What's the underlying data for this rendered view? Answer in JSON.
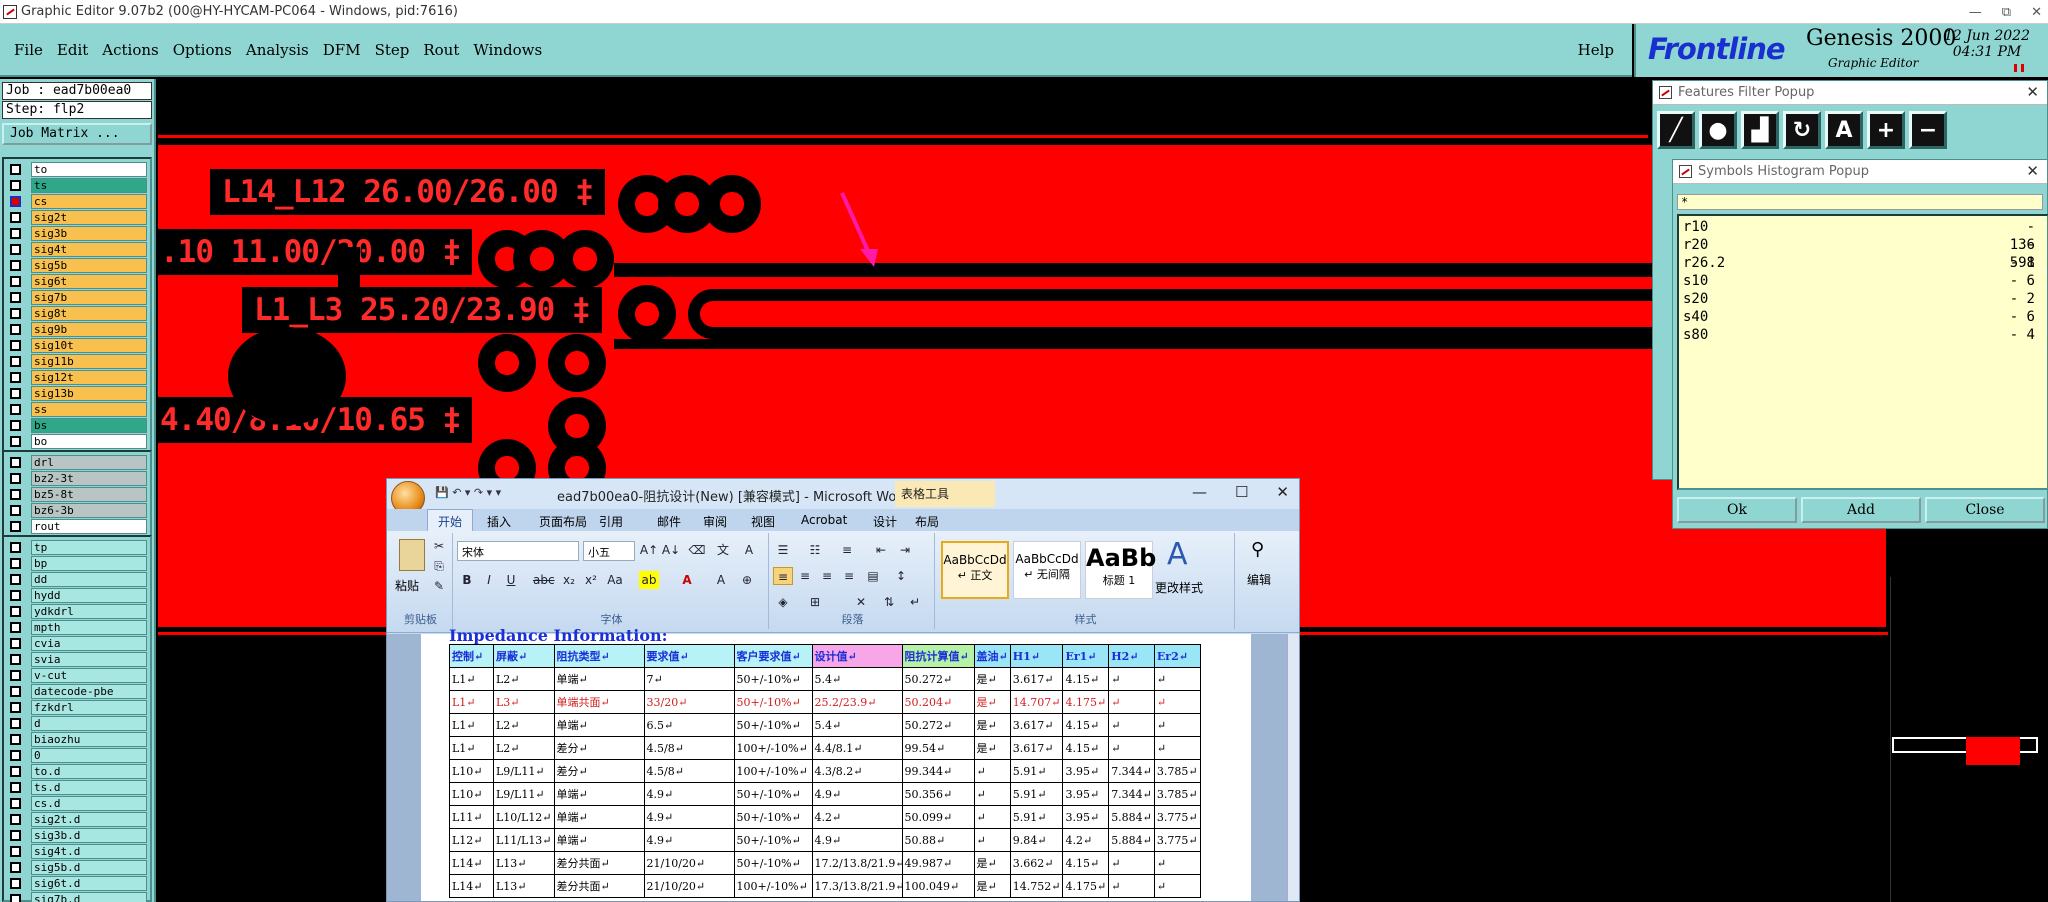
{
  "window": {
    "title": "Graphic Editor 9.07b2 (00@HY-HYCAM-PC064 - Windows, pid:7616)",
    "controls": [
      "—",
      "⧉",
      "✕"
    ]
  },
  "menu": {
    "items": [
      "File",
      "Edit",
      "Actions",
      "Options",
      "Analysis",
      "DFM",
      "Step",
      "Rout",
      "Windows"
    ],
    "help": "Help"
  },
  "brand": {
    "logo": "Frontline",
    "product": "Genesis 2000",
    "subtitle": "Graphic Editor",
    "date": "12 Jun 2022",
    "time": "04:31 PM"
  },
  "job": {
    "job_label": "Job : ead7b00ea0",
    "step_label": "Step: flp2",
    "matrix_button": "Job Matrix ..."
  },
  "layers": {
    "group1": [
      {
        "name": "to",
        "color": "white"
      },
      {
        "name": "ts",
        "color": "teal"
      },
      {
        "name": "cs",
        "color": "orange",
        "active": true
      },
      {
        "name": "sig2t",
        "color": "orange"
      },
      {
        "name": "sig3b",
        "color": "orange"
      },
      {
        "name": "sig4t",
        "color": "orange"
      },
      {
        "name": "sig5b",
        "color": "orange"
      },
      {
        "name": "sig6t",
        "color": "orange"
      },
      {
        "name": "sig7b",
        "color": "orange"
      },
      {
        "name": "sig8t",
        "color": "orange"
      },
      {
        "name": "sig9b",
        "color": "orange"
      },
      {
        "name": "sig10t",
        "color": "orange"
      },
      {
        "name": "sig11b",
        "color": "orange"
      },
      {
        "name": "sig12t",
        "color": "orange"
      },
      {
        "name": "sig13b",
        "color": "orange"
      },
      {
        "name": "ss",
        "color": "orange"
      },
      {
        "name": "bs",
        "color": "teal"
      },
      {
        "name": "bo",
        "color": "white"
      }
    ],
    "group2": [
      {
        "name": "drl",
        "color": "gray"
      },
      {
        "name": "bz2-3t",
        "color": "gray"
      },
      {
        "name": "bz5-8t",
        "color": "gray"
      },
      {
        "name": "bz6-3b",
        "color": "gray"
      },
      {
        "name": "rout",
        "color": "white"
      }
    ],
    "group3": [
      {
        "name": "tp",
        "color": "cyan"
      },
      {
        "name": "bp",
        "color": "cyan"
      },
      {
        "name": "dd",
        "color": "cyan"
      },
      {
        "name": "hydd",
        "color": "cyan"
      },
      {
        "name": "ydkdrl",
        "color": "cyan"
      },
      {
        "name": "mpth",
        "color": "cyan"
      },
      {
        "name": "cvia",
        "color": "cyan"
      },
      {
        "name": "svia",
        "color": "cyan"
      },
      {
        "name": "v-cut",
        "color": "cyan"
      },
      {
        "name": "datecode-pbe",
        "color": "cyan"
      },
      {
        "name": "fzkdrl",
        "color": "cyan"
      },
      {
        "name": "d",
        "color": "cyan"
      },
      {
        "name": "biaozhu",
        "color": "cyan"
      },
      {
        "name": "0",
        "color": "cyan"
      },
      {
        "name": "to.d",
        "color": "cyan"
      },
      {
        "name": "ts.d",
        "color": "cyan"
      },
      {
        "name": "cs.d",
        "color": "cyan"
      },
      {
        "name": "sig2t.d",
        "color": "cyan"
      },
      {
        "name": "sig3b.d",
        "color": "cyan"
      },
      {
        "name": "sig4t.d",
        "color": "cyan"
      },
      {
        "name": "sig5b.d",
        "color": "cyan"
      },
      {
        "name": "sig6t.d",
        "color": "cyan"
      },
      {
        "name": "sig7b.d",
        "color": "cyan"
      }
    ]
  },
  "canvas": {
    "labels": [
      "L14_L12 26.00/26.00 ‡",
      ".10 11.00/20.00 ‡",
      "L1_L3 25.20/23.90 ‡",
      "4.40/8.10/10.65 ‡"
    ],
    "colors": {
      "copper": "#ff0000",
      "background": "#000000",
      "arrow": "#ff1aa8"
    }
  },
  "features_filter": {
    "title": "Features Filter Popup",
    "tools": [
      "line-icon",
      "pad-icon",
      "surface-icon",
      "arc-icon",
      "text-icon",
      "plus-icon",
      "minus-icon"
    ]
  },
  "symbols_histogram": {
    "title": "Symbols Histogram Popup",
    "filter": "*",
    "rows": [
      {
        "sym": "r10",
        "count": "- 136"
      },
      {
        "sym": "r20",
        "count": "- 598"
      },
      {
        "sym": "r26.2",
        "count": "- 1"
      },
      {
        "sym": "s10",
        "count": "- 6"
      },
      {
        "sym": "s20",
        "count": "- 2"
      },
      {
        "sym": "s40",
        "count": "- 6"
      },
      {
        "sym": "s80",
        "count": "- 4"
      }
    ],
    "buttons": {
      "ok": "Ok",
      "add": "Add",
      "close": "Close"
    }
  },
  "word": {
    "title": "ead7b00ea0-阻抗设计(New) [兼容模式] - Microsoft Word",
    "table_tools": "表格工具",
    "tabs": [
      "开始",
      "插入",
      "页面布局",
      "引用",
      "邮件",
      "审阅",
      "视图",
      "Acrobat",
      "设计",
      "布局"
    ],
    "clipboard": {
      "paste": "粘贴",
      "group": "剪贴板"
    },
    "font": {
      "name": "宋体",
      "size": "小五",
      "group": "字体"
    },
    "paragraph": {
      "group": "段落"
    },
    "styles": {
      "s1": "AaBbCcDd",
      "s1_name": "↵ 正文",
      "s2": "AaBbCcDd",
      "s2_name": "↵ 无间隔",
      "s3": "AaBb",
      "s3_name": "标题 1",
      "change": "更改样式",
      "group": "样式"
    },
    "edit": {
      "label": "编辑"
    },
    "doc_heading": "Impedance Information:",
    "table": {
      "headers": [
        "控制↵",
        "屏蔽↵",
        "阻抗类型↵",
        "要求值↵",
        "客户要求值↵",
        "设计值↵",
        "阻抗计算值↵",
        "盖油↵",
        "H1↵",
        "Er1↵",
        "H2↵",
        "Er2↵"
      ],
      "rows": [
        [
          "L1↵",
          "L2↵",
          "单端↵",
          "7↵",
          "50+/-10%↵",
          "5.4↵",
          "50.272↵",
          "是↵",
          "3.617↵",
          "4.15↵",
          "↵",
          "↵"
        ],
        [
          "L1↵",
          "L3↵",
          "单端共面↵",
          "33/20↵",
          "50+/-10%↵",
          "25.2/23.9↵",
          "50.204↵",
          "是↵",
          "14.707↵",
          "4.175↵",
          "↵",
          "↵"
        ],
        [
          "L1↵",
          "L2↵",
          "单端↵",
          "6.5↵",
          "50+/-10%↵",
          "5.4↵",
          "50.272↵",
          "是↵",
          "3.617↵",
          "4.15↵",
          "↵",
          "↵"
        ],
        [
          "L1↵",
          "L2↵",
          "差分↵",
          "4.5/8↵",
          "100+/-10%↵",
          "4.4/8.1↵",
          "99.54↵",
          "是↵",
          "3.617↵",
          "4.15↵",
          "↵",
          "↵"
        ],
        [
          "L10↵",
          "L9/L11↵",
          "差分↵",
          "4.5/8↵",
          "100+/-10%↵",
          "4.3/8.2↵",
          "99.344↵",
          "↵",
          "5.91↵",
          "3.95↵",
          "7.344↵",
          "3.785↵"
        ],
        [
          "L10↵",
          "L9/L11↵",
          "单端↵",
          "4.9↵",
          "50+/-10%↵",
          "4.9↵",
          "50.356↵",
          "↵",
          "5.91↵",
          "3.95↵",
          "7.344↵",
          "3.785↵"
        ],
        [
          "L11↵",
          "L10/L12↵",
          "单端↵",
          "4.9↵",
          "50+/-10%↵",
          "4.2↵",
          "50.099↵",
          "↵",
          "5.91↵",
          "3.95↵",
          "5.884↵",
          "3.775↵"
        ],
        [
          "L12↵",
          "L11/L13↵",
          "单端↵",
          "4.9↵",
          "50+/-10%↵",
          "4.9↵",
          "50.88↵",
          "↵",
          "9.84↵",
          "4.2↵",
          "5.884↵",
          "3.775↵"
        ],
        [
          "L14↵",
          "L13↵",
          "差分共面↵",
          "21/10/20↵",
          "50+/-10%↵",
          "17.2/13.8/21.9↵",
          "49.987↵",
          "是↵",
          "3.662↵",
          "4.15↵",
          "↵",
          "↵"
        ],
        [
          "L14↵",
          "L13↵",
          "差分共面↵",
          "21/10/20↵",
          "100+/-10%↵",
          "17.3/13.8/21.9↵",
          "100.049↵",
          "是↵",
          "14.752↵",
          "4.175↵",
          "↵",
          "↵"
        ]
      ]
    }
  }
}
